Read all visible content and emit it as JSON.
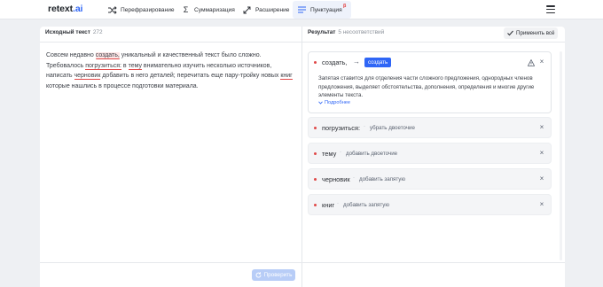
{
  "header": {
    "logo_main": "retext",
    "logo_accent": ".ai",
    "nav": [
      {
        "label": "Перефразирование",
        "icon": "shuffle-icon"
      },
      {
        "label": "Суммаризация",
        "icon": "sigma-icon"
      },
      {
        "label": "Расширение",
        "icon": "expand-icon"
      },
      {
        "label": "Пунктуация",
        "icon": "list-icon",
        "badge": "β",
        "active": true
      }
    ],
    "menu_icon": "hamburger-icon"
  },
  "source": {
    "title": "Исходный текст",
    "count": "272",
    "segments": [
      {
        "t": "Совсем недавно ",
        "err": false
      },
      {
        "t": "создать,",
        "err": true,
        "selected": true
      },
      {
        "t": " уникальный и качественный текст было сложно. Требовалось ",
        "err": false
      },
      {
        "t": "погрузиться:",
        "err": true
      },
      {
        "t": " в ",
        "err": false
      },
      {
        "t": "тему",
        "err": true
      },
      {
        "t": " внимательно изучить несколько источников, написать ",
        "err": false
      },
      {
        "t": "черновик",
        "err": true
      },
      {
        "t": " добавить в него деталей; перечитать еще пару-тройку новых ",
        "err": false
      },
      {
        "t": "книг",
        "err": true
      },
      {
        "t": " которые нашлись в процессе подготовки материала.",
        "err": false
      }
    ],
    "check_button": "Проверить"
  },
  "result": {
    "title": "Результат",
    "count": "5 несоответствий",
    "apply_all": "Применить всё",
    "main_card": {
      "word": "создать,",
      "arrow": "→",
      "suggestion": "создать",
      "description": "Запятая ставится для отделения части сложного предложения, однородных членов предложения, выделяет обстоятельства, дополнения, определения и многие другие элементы текста.",
      "more": "Подробнее"
    },
    "items": [
      {
        "word": "погрузиться:",
        "hint": "убрать двоеточие"
      },
      {
        "word": "тему",
        "hint": "добавить двоеточие"
      },
      {
        "word": "черновик",
        "hint": "добавить запятую"
      },
      {
        "word": "книг",
        "hint": "добавить запятую"
      }
    ]
  },
  "colors": {
    "accent": "#2f66f6",
    "error": "#e04848",
    "bg": "#eef0f3"
  }
}
